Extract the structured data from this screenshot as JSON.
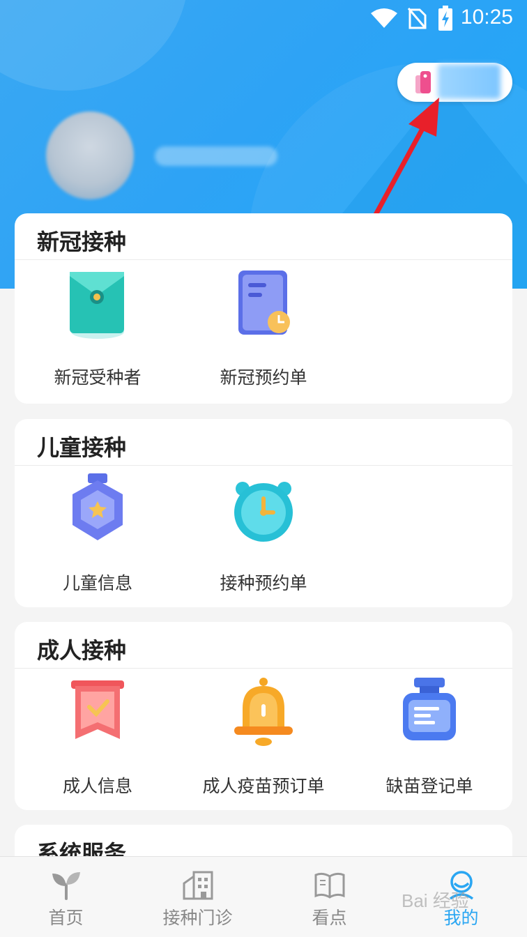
{
  "status_bar": {
    "time": "10:25"
  },
  "sections": [
    {
      "title": "新冠接种",
      "items": [
        {
          "label": "新冠受种者"
        },
        {
          "label": "新冠预约单"
        }
      ]
    },
    {
      "title": "儿童接种",
      "items": [
        {
          "label": "儿童信息"
        },
        {
          "label": "接种预约单"
        }
      ]
    },
    {
      "title": "成人接种",
      "items": [
        {
          "label": "成人信息"
        },
        {
          "label": "成人疫苗预订单"
        },
        {
          "label": "缺苗登记单"
        }
      ]
    },
    {
      "title": "系统服务",
      "items": []
    }
  ],
  "tabs": [
    {
      "label": "首页",
      "icon": "sprout-icon",
      "active": false
    },
    {
      "label": "接种门诊",
      "icon": "building-icon",
      "active": false
    },
    {
      "label": "看点",
      "icon": "book-icon",
      "active": false
    },
    {
      "label": "我的",
      "icon": "profile-icon",
      "active": true
    }
  ],
  "watermark": "Bai 经验",
  "colors": {
    "accent": "#2aa6f2",
    "header_bg": "#2ea3f5",
    "arrow": "#e8202a"
  }
}
